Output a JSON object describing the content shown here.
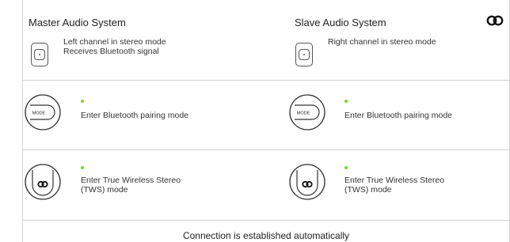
{
  "master": {
    "title": "Master Audio System",
    "desc_line1": "Left channel in stereo mode",
    "desc_line2": "Receives Bluetooth signal",
    "step1": "Enter Bluetooth pairing mode",
    "step2_line1": "Enter True Wireless Stereo",
    "step2_line2": "(TWS) mode",
    "mode_label": "MODE"
  },
  "slave": {
    "title": "Slave Audio System",
    "desc_line1": "Right channel in stereo mode",
    "step1": "Enter Bluetooth pairing mode",
    "step2_line1": "Enter True Wireless Stereo",
    "step2_line2": "(TWS) mode",
    "mode_label": "MODE"
  },
  "footer": "Connection is established automatically",
  "colors": {
    "accent_dot": "#7ed321",
    "line": "#d6d6d6",
    "text": "#222222"
  },
  "icons": [
    "speaker-icon",
    "mode-button-icon",
    "tws-button-icon",
    "brand-logo-icon"
  ]
}
